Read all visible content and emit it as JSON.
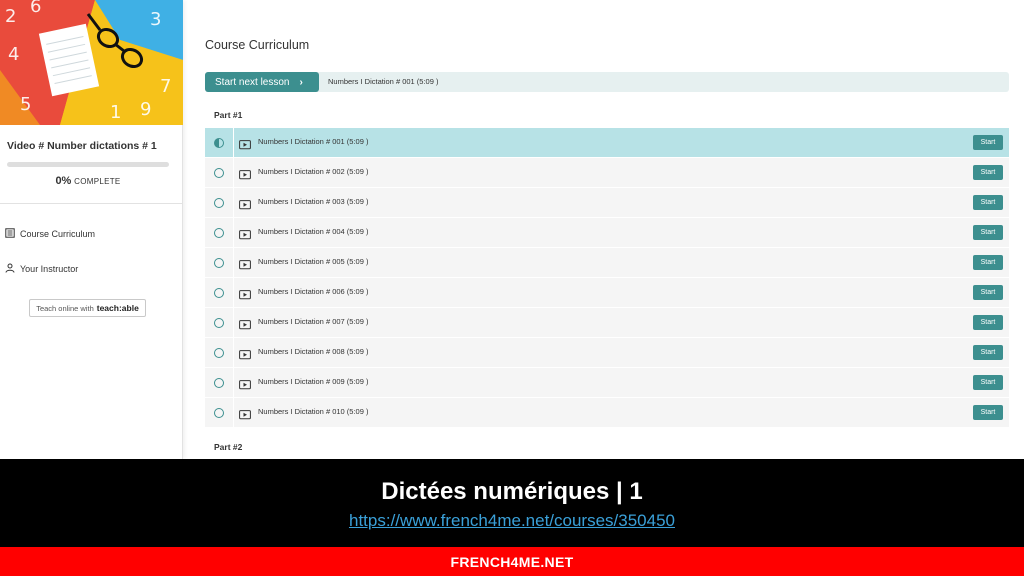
{
  "sidebar": {
    "course_title": "Video # Number dictations # 1",
    "progress": {
      "percent": 0,
      "percent_label": "0%",
      "complete_word": "COMPLETE"
    },
    "links": [
      {
        "label": "Course Curriculum",
        "icon": "curriculum-icon"
      },
      {
        "label": "Your Instructor",
        "icon": "person-icon"
      }
    ],
    "teachable": {
      "prefix": "Teach online with",
      "brand": "teach:able"
    }
  },
  "main": {
    "title": "Course Curriculum",
    "next_lesson": {
      "button_label": "Start next lesson",
      "chevron": "›",
      "lesson": "Numbers I Dictation # 001 (5:09 )"
    },
    "sections": [
      {
        "title": "Part #1",
        "lessons": [
          {
            "label": "Numbers I Dictation # 001 (5:09 )",
            "active": true
          },
          {
            "label": "Numbers I Dictation # 002 (5:09 )",
            "active": false
          },
          {
            "label": "Numbers I Dictation # 003 (5:09 )",
            "active": false
          },
          {
            "label": "Numbers I Dictation # 004 (5:09 )",
            "active": false
          },
          {
            "label": "Numbers I Dictation # 005 (5:09 )",
            "active": false
          },
          {
            "label": "Numbers I Dictation # 006 (5:09 )",
            "active": false
          },
          {
            "label": "Numbers I Dictation # 007 (5:09 )",
            "active": false
          },
          {
            "label": "Numbers I Dictation # 008 (5:09 )",
            "active": false
          },
          {
            "label": "Numbers I Dictation # 009 (5:09 )",
            "active": false
          },
          {
            "label": "Numbers I Dictation # 010 (5:09 )",
            "active": false
          }
        ]
      },
      {
        "title": "Part #2",
        "lessons": []
      }
    ],
    "start_label": "Start"
  },
  "caption": {
    "title": "Dictées numériques | 1",
    "url": "https://www.french4me.net/courses/350450"
  },
  "footer": {
    "label": "FRENCH4ME.NET"
  },
  "colors": {
    "accent": "#3c8f8f",
    "active_row": "#b7e2e6",
    "footer_red": "#ff0000",
    "link_blue": "#3aa0d8"
  }
}
